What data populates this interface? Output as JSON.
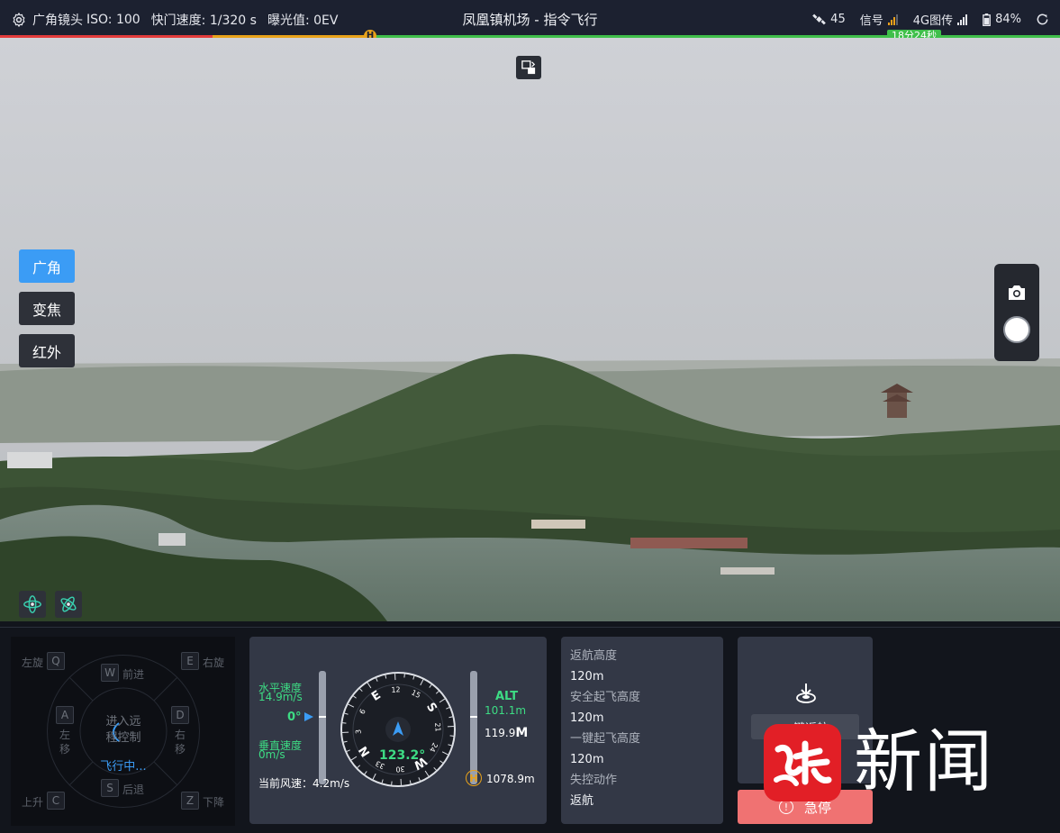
{
  "topbar": {
    "lens_label": "广角镜头",
    "iso": "ISO: 100",
    "shutter": "快门速度: 1/320 s",
    "exposure": "曝光值: 0EV",
    "title": "凤凰镇机场 - 指令飞行",
    "satellites": "45",
    "signal_label": "信号",
    "image_link_label": "4G图传",
    "battery": "84%",
    "home_marker": "H",
    "flight_time": "18分24秒",
    "battery_level": 0.84
  },
  "video": {
    "lens_modes": [
      "广角",
      "变焦",
      "红外"
    ],
    "active_lens": "广角"
  },
  "joystick": {
    "rotate_left": "左旋",
    "key_q": "Q",
    "rotate_right": "右旋",
    "key_e": "E",
    "forward": "前进",
    "key_w": "W",
    "left": "左移",
    "key_a": "A",
    "right": "右移",
    "key_d": "D",
    "backward": "后退",
    "key_s": "S",
    "ascend": "上升",
    "key_c": "C",
    "descend": "下降",
    "key_z": "Z",
    "center_line1": "进入远",
    "center_line2": "程控制",
    "status": "飞行中..."
  },
  "flight": {
    "h_speed_label": "水平速度",
    "h_speed": "14.9m/s",
    "pitch": "0°",
    "v_speed_label": "垂直速度",
    "v_speed": "0m/s",
    "heading": "123.2°",
    "compass_ticks": [
      "N",
      "3",
      "6",
      "E",
      "12",
      "15",
      "S",
      "21",
      "24",
      "W",
      "30",
      "33"
    ],
    "alt_label": "ALT",
    "alt_value": "101.1m",
    "height_value": "119.9",
    "height_unit": "M",
    "home_distance": "1078.9m",
    "home_marker": "H",
    "wind_speed": "当前风速：4.2m/s"
  },
  "params": {
    "rth_alt_label": "返航高度",
    "rth_alt": "120m",
    "safe_takeoff_label": "安全起飞高度",
    "safe_takeoff": "120m",
    "one_key_takeoff_label": "一键起飞高度",
    "one_key_takeoff": "120m",
    "lost_link_label": "失控动作",
    "lost_link": "返航"
  },
  "actions": {
    "rth_button": "一键返航",
    "estop_button": "急停",
    "estop_icon": "!"
  },
  "watermark": {
    "logo_text": "荔枝",
    "text": "新闻"
  },
  "colors": {
    "accent_blue": "#3b9cf5",
    "telemetry_green": "#3ddc84",
    "estop_red": "#f07272",
    "brand_red": "#e21f26"
  }
}
